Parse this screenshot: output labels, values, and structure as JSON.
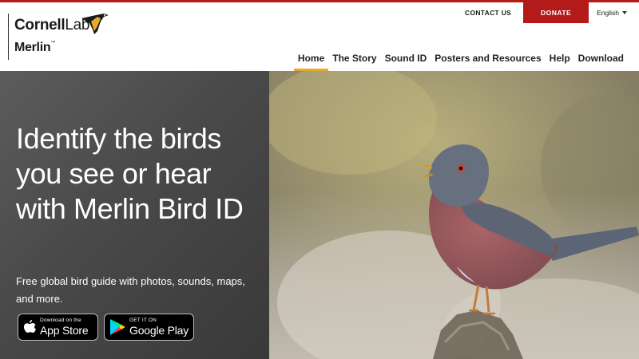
{
  "logo": {
    "org_bold": "Cornell",
    "org_light": "Lab",
    "product": "Merlin",
    "trademark": "™"
  },
  "utility": {
    "contact": "CONTACT US",
    "donate": "DONATE",
    "language": "English"
  },
  "nav": {
    "items": [
      {
        "label": "Home",
        "active": true
      },
      {
        "label": "The Story",
        "active": false
      },
      {
        "label": "Sound ID",
        "active": false
      },
      {
        "label": "Posters and Resources",
        "active": false
      },
      {
        "label": "Help",
        "active": false
      },
      {
        "label": "Download",
        "active": false
      }
    ]
  },
  "hero": {
    "headline": "Identify the birds you see or hear with Merlin Bird ID",
    "subtitle": "Free global bird guide with photos, sounds, maps, and more.",
    "app_store": {
      "small": "Download on the",
      "big": "App Store",
      "icon": "apple-icon"
    },
    "google_play": {
      "small": "GET IT ON",
      "big": "Google Play",
      "icon": "google-play-icon"
    }
  },
  "colors": {
    "brand_red": "#b31b1b",
    "nav_active_underline": "#e8a92b",
    "hero_panel": "#4a4949"
  }
}
